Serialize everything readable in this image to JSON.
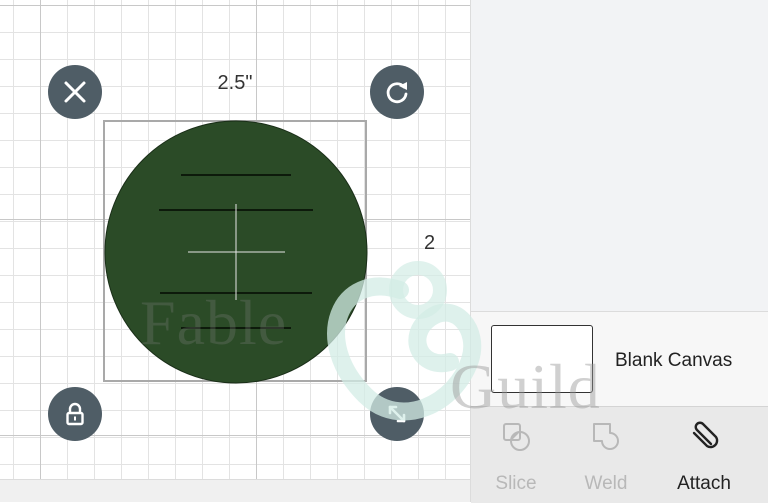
{
  "canvas": {
    "width_dimension": "2.5\"",
    "height_dimension": "2",
    "shape_color": "#2b4b27",
    "handle_color": "#4f5d66"
  },
  "handles": {
    "delete": "close-icon",
    "rotate": "rotate-icon",
    "lock": "lock-icon",
    "resize": "resize-icon"
  },
  "layers_panel": {
    "canvas_layer_label": "Blank Canvas"
  },
  "toolbar": {
    "slice_label": "Slice",
    "weld_label": "Weld",
    "attach_label": "Attach"
  },
  "watermark": {
    "word1": "Fable",
    "word2": "Guild"
  }
}
